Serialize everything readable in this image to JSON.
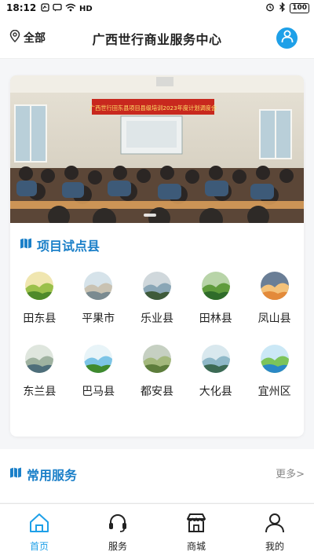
{
  "status_bar": {
    "time": "18:12",
    "network": "HD",
    "battery": "100"
  },
  "header": {
    "location_label": "全部",
    "title": "广西世行商业服务中心"
  },
  "banner": {
    "sign_text": "广西世行田东县项目县级培训2023年度计划调度会"
  },
  "pilot_section": {
    "title": "项目试点县",
    "counties": [
      {
        "name": "田东县"
      },
      {
        "name": "平果市"
      },
      {
        "name": "乐业县"
      },
      {
        "name": "田林县"
      },
      {
        "name": "凤山县"
      },
      {
        "name": "东兰县"
      },
      {
        "name": "巴马县"
      },
      {
        "name": "都安县"
      },
      {
        "name": "大化县"
      },
      {
        "name": "宜州区"
      }
    ]
  },
  "services_section": {
    "title": "常用服务",
    "more_label": "更多>"
  },
  "tabbar": {
    "tabs": [
      {
        "label": "首页",
        "icon": "home-icon",
        "active": true
      },
      {
        "label": "服务",
        "icon": "headset-icon",
        "active": false
      },
      {
        "label": "商城",
        "icon": "store-icon",
        "active": false
      },
      {
        "label": "我的",
        "icon": "user-icon",
        "active": false
      }
    ]
  },
  "colors": {
    "accent": "#1ea0e8",
    "section_title": "#1a7fc8",
    "background": "#f5f6f8"
  }
}
